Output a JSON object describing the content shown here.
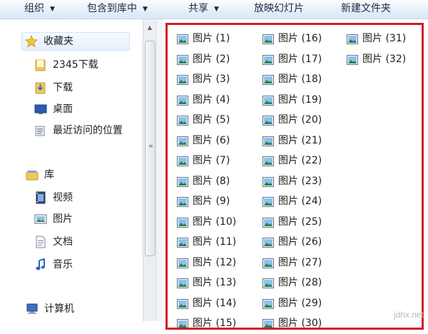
{
  "toolbar": {
    "organize": "组织",
    "include_in_library": "包含到库中",
    "share": "共享",
    "slideshow": "放映幻灯片",
    "new_folder": "新建文件夹"
  },
  "nav": {
    "favorites": {
      "label": "收藏夹",
      "items": [
        "2345下载",
        "下载",
        "桌面",
        "最近访问的位置"
      ]
    },
    "libraries": {
      "label": "库",
      "items": [
        "视频",
        "图片",
        "文档",
        "音乐"
      ]
    },
    "computer": {
      "label": "计算机"
    }
  },
  "files": [
    "图片 (1)",
    "图片 (2)",
    "图片 (3)",
    "图片 (4)",
    "图片 (5)",
    "图片 (6)",
    "图片 (7)",
    "图片 (8)",
    "图片 (9)",
    "图片 (10)",
    "图片 (11)",
    "图片 (12)",
    "图片 (13)",
    "图片 (14)",
    "图片 (15)",
    "图片 (16)",
    "图片 (17)",
    "图片 (18)",
    "图片 (19)",
    "图片 (20)",
    "图片 (21)",
    "图片 (22)",
    "图片 (23)",
    "图片 (24)",
    "图片 (25)",
    "图片 (26)",
    "图片 (27)",
    "图片 (28)",
    "图片 (29)",
    "图片 (30)",
    "图片 (31)",
    "图片 (32)"
  ],
  "watermark": "jdhx.net",
  "colors": {
    "highlight_border": "#d01d28",
    "toolbar_text": "#1d2a44"
  }
}
